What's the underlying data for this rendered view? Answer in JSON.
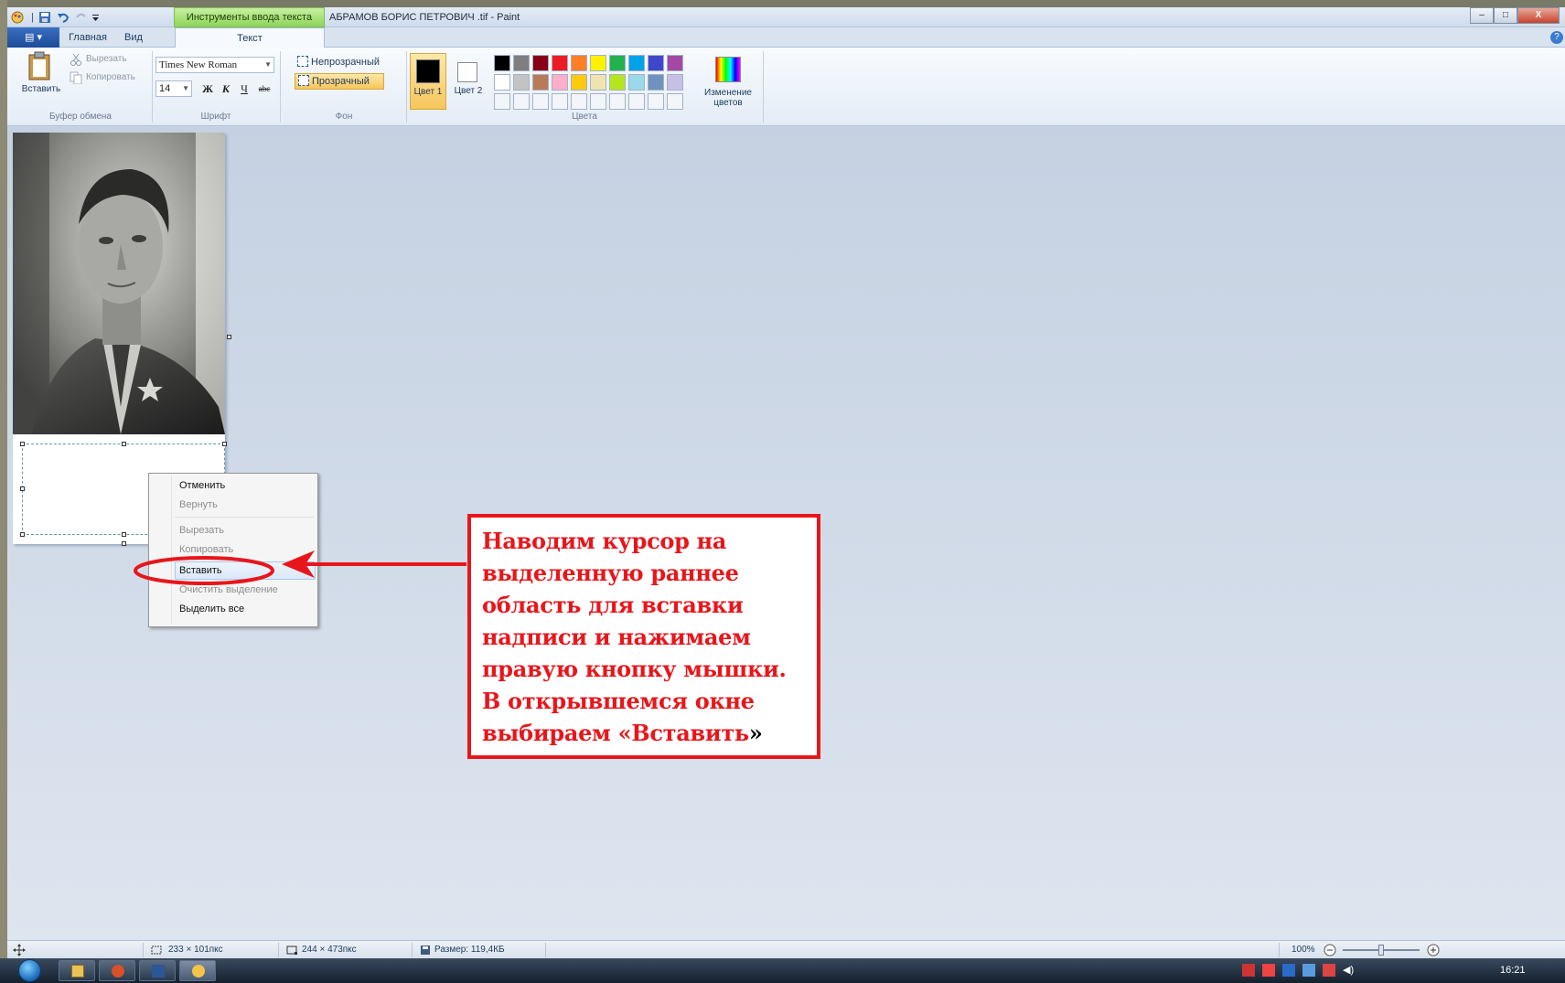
{
  "window": {
    "title": "АБРАМОВ БОРИС ПЕТРОВИЧ .tif - Paint",
    "context_tab_group": "Инструменты ввода текста",
    "controls": {
      "minimize": "–",
      "maximize": "□",
      "close": "X"
    }
  },
  "ribbon_tabs": {
    "app_menu": "▤ ▾",
    "tabs": [
      "Главная",
      "Вид",
      "Текст"
    ],
    "active": "Текст",
    "help": "?"
  },
  "clipboard": {
    "paste": "Вставить",
    "cut": "Вырезать",
    "copy": "Копировать",
    "group_label": "Буфер обмена"
  },
  "font": {
    "family": "Times New Roman",
    "size": "14",
    "bold": "Ж",
    "italic": "К",
    "underline": "Ч",
    "strike": "abc",
    "group_label": "Шрифт"
  },
  "background": {
    "opaque": "Непрозрачный",
    "transparent": "Прозрачный",
    "selected": "Прозрачный",
    "group_label": "Фон"
  },
  "colors": {
    "color1_label": "Цвет 1",
    "color2_label": "Цвет 2",
    "color1_value": "#000000",
    "color2_value": "#ffffff",
    "edit_label": "Изменение цветов",
    "group_label": "Цвета",
    "palette_row1": [
      "#000000",
      "#7f7f7f",
      "#880015",
      "#ed1c24",
      "#ff7f27",
      "#fff200",
      "#22b14c",
      "#00a2e8",
      "#3f48cc",
      "#a349a4"
    ],
    "palette_row2": [
      "#ffffff",
      "#c3c3c3",
      "#b97a57",
      "#ffaec9",
      "#ffc90e",
      "#efe4b0",
      "#b5e61d",
      "#99d9ea",
      "#7092be",
      "#c8bfe7"
    ]
  },
  "context_menu": {
    "items": [
      {
        "label": "Отменить",
        "enabled": true
      },
      {
        "label": "Вернуть",
        "enabled": false
      },
      {
        "label": "Вырезать",
        "enabled": false
      },
      {
        "label": "Копировать",
        "enabled": false
      },
      {
        "label": "Вставить",
        "enabled": true,
        "highlighted": true
      },
      {
        "label": "Очистить выделение",
        "enabled": false
      },
      {
        "label": "Выделить все",
        "enabled": true
      }
    ]
  },
  "callout": {
    "text": "Наводим курсор на выделенную раннее область для вставки надписи и нажимаем правую кнопку мышки. В открывшемся окне выбираем «Вставить",
    "close_quote": "»",
    "color": "#e8161b"
  },
  "statusbar": {
    "selection_size": "233 × 101пкс",
    "image_size": "244 × 473пкс",
    "file_size": "Размер: 119,4КБ",
    "zoom": "100%",
    "zoom_level_percent": 100
  },
  "taskbar": {
    "clock": "16:21",
    "apps": [
      "explorer-icon",
      "presentation-icon",
      "word-icon",
      "paint-icon"
    ]
  }
}
